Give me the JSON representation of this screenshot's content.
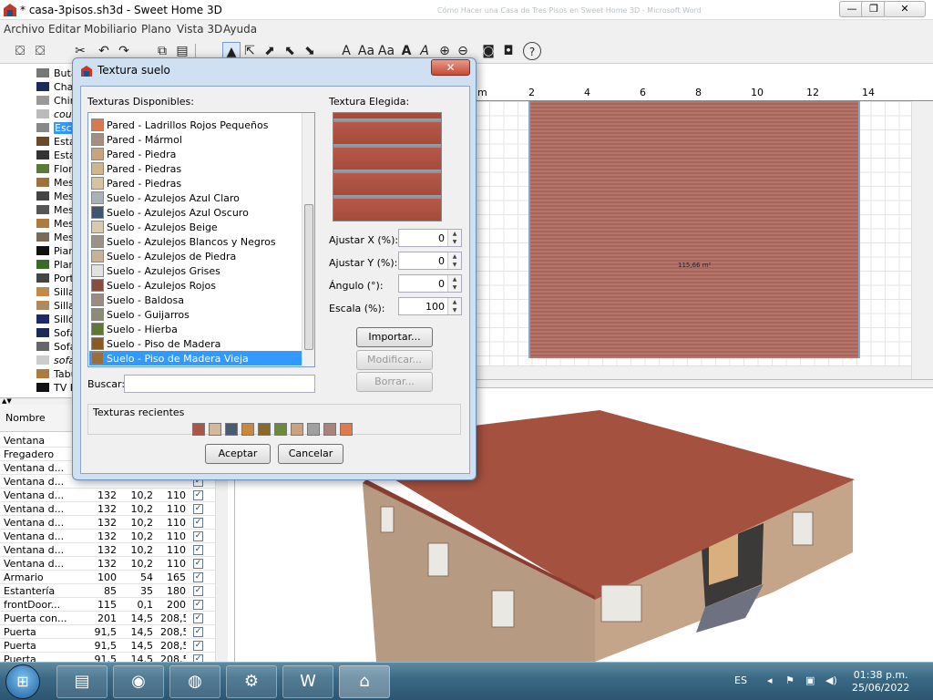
{
  "window": {
    "title": "* casa-3pisos.sh3d - Sweet Home 3D",
    "ghost_title": "Cómo Hacer una Casa de Tres Pisos en Sweet Home 3D - Microsoft Word",
    "min": "—",
    "max": "❐",
    "close": "✕"
  },
  "menu": [
    "Archivo",
    "Editar",
    "Mobiliario",
    "Plano",
    "Vista 3D",
    "Ayuda"
  ],
  "toolbar": {
    "icons": [
      "⛋",
      "⛋",
      "✂",
      "↶",
      "↷",
      "⧉",
      "▤",
      "▲",
      "⇱",
      "⬈",
      "⬉",
      "⬊",
      "A",
      "Aa",
      "Aa",
      "A",
      "A",
      "⊕",
      "⊖",
      "◙",
      "◘",
      "?"
    ]
  },
  "catalog": {
    "items": [
      "Butaca",
      "Chaise",
      "Chimenea",
      "couch",
      "Escalera",
      "Estantería",
      "Estantería",
      "Flor",
      "Mesa",
      "Mesa",
      "Mesa",
      "Mesa",
      "Mesa",
      "Piano",
      "Planta",
      "Portátil",
      "Silla",
      "Silla",
      "Sillón",
      "Sofá",
      "Sofá",
      "sofa",
      "Taburete",
      "TV P"
    ]
  },
  "furniture_table": {
    "header_name": "Nombre",
    "rows": [
      {
        "name": "Ventana",
        "w": "",
        "d": "",
        "h": "",
        "visible": true
      },
      {
        "name": "Fregadero",
        "w": "",
        "d": "",
        "h": "",
        "visible": true
      },
      {
        "name": "Ventana d...",
        "w": "",
        "d": "",
        "h": "",
        "visible": true
      },
      {
        "name": "Ventana d...",
        "w": "",
        "d": "",
        "h": "",
        "visible": true
      },
      {
        "name": "Ventana d...",
        "w": "132",
        "d": "10,2",
        "h": "110",
        "visible": true
      },
      {
        "name": "Ventana d...",
        "w": "132",
        "d": "10,2",
        "h": "110",
        "visible": true
      },
      {
        "name": "Ventana d...",
        "w": "132",
        "d": "10,2",
        "h": "110",
        "visible": true
      },
      {
        "name": "Ventana d...",
        "w": "132",
        "d": "10,2",
        "h": "110",
        "visible": true
      },
      {
        "name": "Ventana d...",
        "w": "132",
        "d": "10,2",
        "h": "110",
        "visible": true
      },
      {
        "name": "Ventana d...",
        "w": "132",
        "d": "10,2",
        "h": "110",
        "visible": true
      },
      {
        "name": "Armario",
        "w": "100",
        "d": "54",
        "h": "165",
        "visible": true
      },
      {
        "name": "Estantería",
        "w": "85",
        "d": "35",
        "h": "180",
        "visible": true
      },
      {
        "name": "frontDoor...",
        "w": "115",
        "d": "0,1",
        "h": "200",
        "visible": true
      },
      {
        "name": "Puerta con...",
        "w": "201",
        "d": "14,5",
        "h": "208,5",
        "visible": true
      },
      {
        "name": "Puerta",
        "w": "91,5",
        "d": "14,5",
        "h": "208,5",
        "visible": true
      },
      {
        "name": "Puerta",
        "w": "91,5",
        "d": "14,5",
        "h": "208,5",
        "visible": true
      },
      {
        "name": "Puerta",
        "w": "91,5",
        "d": "14,5",
        "h": "208,5",
        "visible": true
      },
      {
        "name": "Puerta",
        "w": "91,5",
        "d": "14,5",
        "h": "208,5",
        "visible": true
      }
    ]
  },
  "plan": {
    "ruler": [
      "m",
      "2",
      "4",
      "6",
      "8",
      "10",
      "12",
      "14"
    ],
    "area": "115,66 m²"
  },
  "dialog": {
    "title": "Textura suelo",
    "available_label": "Texturas Disponibles:",
    "chosen_label": "Textura Elegida:",
    "textures": [
      {
        "name": "Pared - Ladrillos Rojos Pequeños",
        "color": "#d9794f"
      },
      {
        "name": "Pared - Mármol",
        "color": "#a48e80"
      },
      {
        "name": "Pared - Piedra",
        "color": "#c9a27e"
      },
      {
        "name": "Pared - Piedras",
        "color": "#cfb48c"
      },
      {
        "name": "Pared - Piedras",
        "color": "#d6c3a2"
      },
      {
        "name": "Suelo - Azulejos Azul Claro",
        "color": "#aab0b8"
      },
      {
        "name": "Suelo - Azulejos Azul Oscuro",
        "color": "#3e5470"
      },
      {
        "name": "Suelo - Azulejos Beige",
        "color": "#d9c9ae"
      },
      {
        "name": "Suelo - Azulejos Blancos y Negros",
        "color": "#9c9286"
      },
      {
        "name": "Suelo - Azulejos de Piedra",
        "color": "#c6b199"
      },
      {
        "name": "Suelo - Azulejos Grises",
        "color": "#e2e2e2"
      },
      {
        "name": "Suelo - Azulejos Rojos",
        "color": "#8a4c3e"
      },
      {
        "name": "Suelo - Baldosa",
        "color": "#9a8c80"
      },
      {
        "name": "Suelo - Guijarros",
        "color": "#8d8a76"
      },
      {
        "name": "Suelo - Hierba",
        "color": "#5e7a32"
      },
      {
        "name": "Suelo - Piso de Madera",
        "color": "#8a5a22"
      },
      {
        "name": "Suelo - Piso de Madera Vieja",
        "color": "#9a6e3c"
      }
    ],
    "selected_index": 16,
    "fields": [
      {
        "label": "Ajustar X (%):",
        "value": "0"
      },
      {
        "label": "Ajustar Y (%):",
        "value": "0"
      },
      {
        "label": "Ángulo (°):",
        "value": "0"
      },
      {
        "label": "Escala (%):",
        "value": "100"
      }
    ],
    "import_btn": "Importar...",
    "modify_btn": "Modificar...",
    "delete_btn": "Borrar...",
    "search_label": "Buscar:",
    "search_value": "",
    "recent_label": "Texturas recientes",
    "recent_colors": [
      "#a8584a",
      "#d4b89a",
      "#4a5a72",
      "#c78a3c",
      "#8a6a2c",
      "#6c8a3c",
      "#c9a27e",
      "#a0a0a0",
      "#a8847a",
      "#e07a4a"
    ],
    "ok_btn": "Aceptar",
    "cancel_btn": "Cancelar"
  },
  "taskbar": {
    "lang": "ES",
    "time": "01:38 p.m.",
    "date": "25/06/2022"
  }
}
